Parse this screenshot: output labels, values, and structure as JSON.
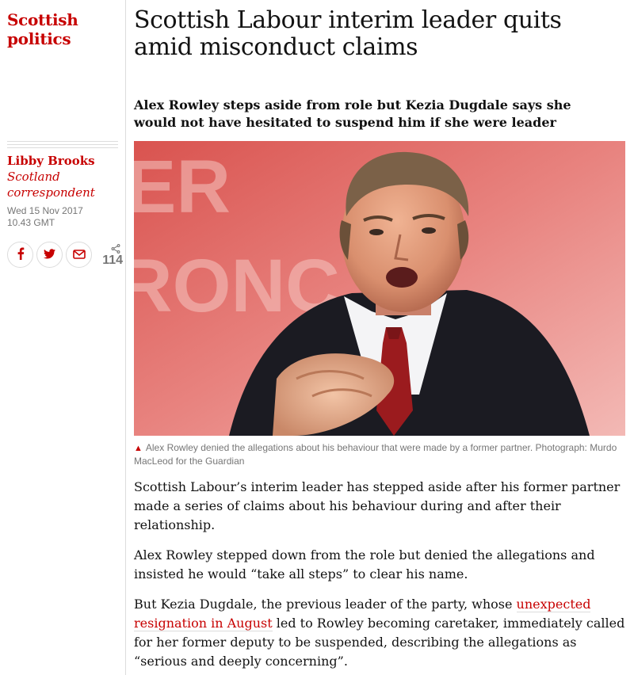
{
  "section": {
    "label": "Scottish politics"
  },
  "byline": {
    "name": "Libby Brooks",
    "role": "Scotland correspondent",
    "date": "Wed 15 Nov 2017",
    "time": "10.43 GMT"
  },
  "share": {
    "count": "114",
    "icons": [
      "facebook-icon",
      "twitter-icon",
      "email-icon",
      "share-icon"
    ]
  },
  "article": {
    "headline": "Scottish Labour interim leader quits amid misconduct claims",
    "standfirst": "Alex Rowley steps aside from role but Kezia Dugdale says she would not have hesitated to suspend him if she were leader",
    "caption": "Alex Rowley denied the allegations about his behaviour that were made by a former partner. Photograph: Murdo MacLeod for the Guardian",
    "paragraphs": [
      "Scottish Labour’s interim leader has stepped aside after his former partner made a series of claims about his behaviour during and after their relationship.",
      "Alex Rowley stepped down from the role but denied the allegations and insisted he would “take all steps” to clear his name."
    ],
    "para3": {
      "before": "But Kezia Dugdale, the previous leader of the party, whose ",
      "link": "unexpected resignation in August",
      "after": " led to Rowley becoming caretaker, immediately called for her former deputy to be suspended, describing the allegations as “serious and deeply concerning”."
    }
  },
  "colors": {
    "accent": "#c70000",
    "text": "#121212",
    "muted": "#767676",
    "divider": "#dcdcdc"
  }
}
